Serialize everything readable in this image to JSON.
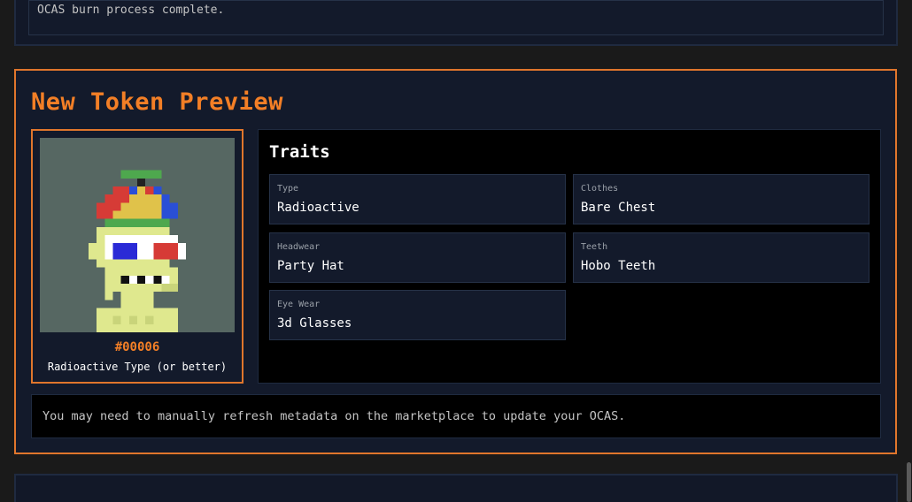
{
  "status": {
    "message": "OCAS burn process complete."
  },
  "preview": {
    "title": "New Token Preview",
    "token": {
      "id": "#00006",
      "description": "Radioactive Type (or better)",
      "background_color": "#566762"
    },
    "traits": {
      "title": "Traits",
      "items": [
        {
          "label": "Type",
          "value": "Radioactive"
        },
        {
          "label": "Clothes",
          "value": "Bare Chest"
        },
        {
          "label": "Headwear",
          "value": "Party Hat"
        },
        {
          "label": "Teeth",
          "value": "Hobo Teeth"
        },
        {
          "label": "Eye Wear",
          "value": "3d Glasses"
        }
      ]
    },
    "notice": "You may need to manually refresh metadata on the marketplace to update your OCAS."
  },
  "colors": {
    "accent": "#f37f26",
    "panel": "#131a2b",
    "page": "#1a1a1a"
  }
}
